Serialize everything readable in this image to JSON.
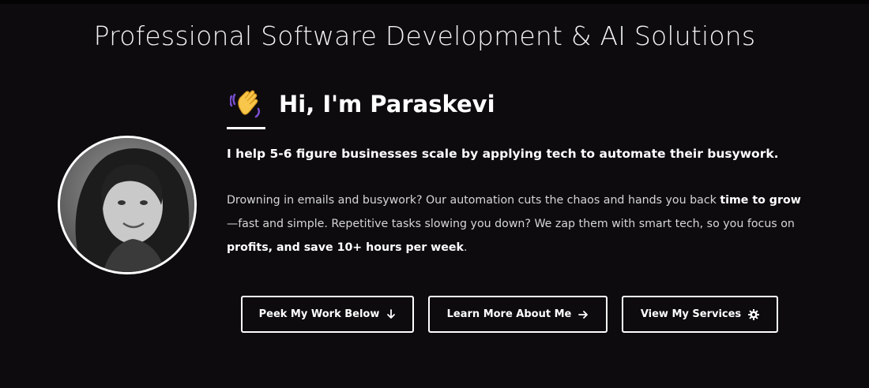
{
  "header": {
    "title": "Professional Software Development & AI Solutions"
  },
  "profile": {
    "greeting": "Hi, I'm Paraskevi",
    "greeting_icon": "waving-hand-icon",
    "avatar": "profile-photo"
  },
  "intro": {
    "tagline": "I help 5-6 figure businesses scale by applying tech to automate their busywork.",
    "description": {
      "part1": "Drowning in emails and busywork? Our automation cuts the chaos and hands you back ",
      "bold1": "time to grow",
      "part2": "—fast and simple. Repetitive tasks slowing you down? We zap them with smart tech, so you focus on ",
      "bold2": "profits, and save 10+ hours per week",
      "part3": "."
    }
  },
  "actions": {
    "peek_work": {
      "label": "Peek My Work Below",
      "icon": "arrow-down-icon"
    },
    "learn_more": {
      "label": "Learn More About Me",
      "icon": "arrow-right-icon"
    },
    "view_services": {
      "label": "View My Services",
      "icon": "gear-icon"
    }
  },
  "colors": {
    "background": "#0d0b0e",
    "text": "#ffffff",
    "muted_text": "#d6d6d6",
    "wave_hand": "#f7c64a",
    "wave_motion": "#7a4fd0"
  }
}
